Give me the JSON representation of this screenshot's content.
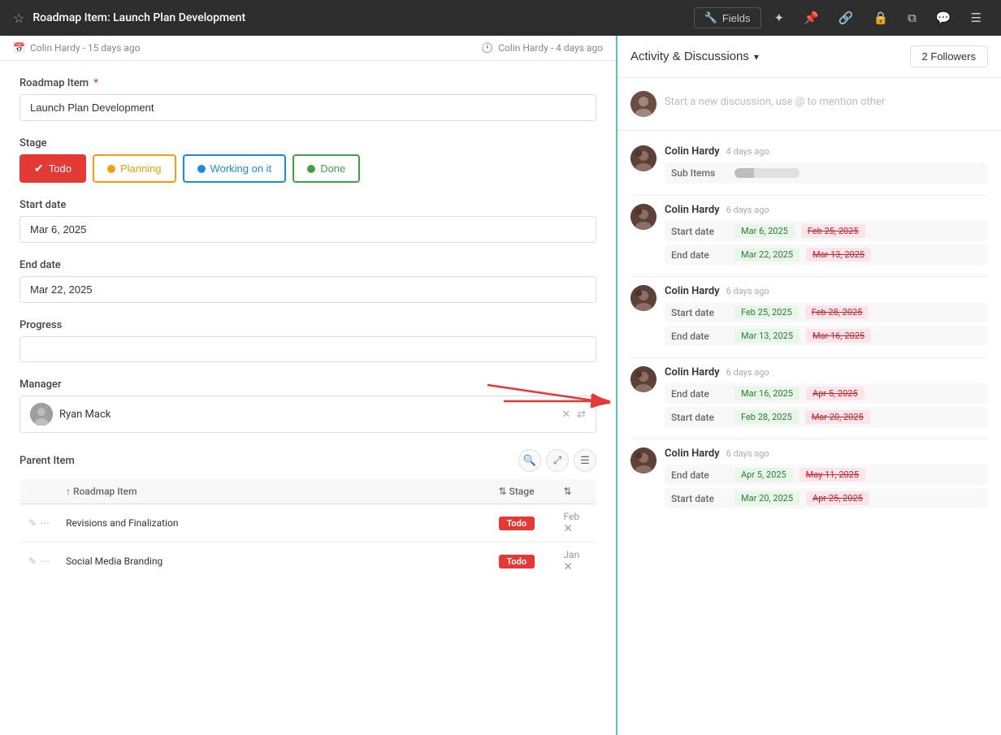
{
  "topbar": {
    "title": "Roadmap Item: Launch Plan Development",
    "fields_label": "Fields"
  },
  "panel_header": {
    "created_by": "Colin Hardy",
    "created_days": "15 days ago",
    "modified_by": "Colin Hardy",
    "modified_days": "4 days ago"
  },
  "form": {
    "roadmap_label": "Roadmap Item",
    "roadmap_value": "Launch Plan Development",
    "stage_label": "Stage",
    "stages": [
      {
        "key": "todo",
        "label": "Todo",
        "class": "todo"
      },
      {
        "key": "planning",
        "label": "Planning",
        "class": "planning"
      },
      {
        "key": "working",
        "label": "Working on it",
        "class": "working"
      },
      {
        "key": "done",
        "label": "Done",
        "class": "done"
      }
    ],
    "start_date_label": "Start date",
    "start_date_value": "Mar 6, 2025",
    "end_date_label": "End date",
    "end_date_value": "Mar 22, 2025",
    "progress_label": "Progress",
    "manager_label": "Manager",
    "manager_name": "Ryan Mack",
    "parent_item_label": "Parent Item",
    "table_headers": [
      "Roadmap Item",
      "Stage",
      ""
    ],
    "table_rows": [
      {
        "name": "Revisions and Finalization",
        "stage": "Todo",
        "date": "Feb"
      },
      {
        "name": "Social Media Branding",
        "stage": "Todo",
        "date": "Jan"
      }
    ]
  },
  "right_panel": {
    "activity_label": "Activity & Discussions",
    "followers_label": "2 Followers",
    "discussion_placeholder": "Start a new discussion, use @ to mention other",
    "activities": [
      {
        "user": "Colin Hardy",
        "time": "4 days ago",
        "changes": [
          {
            "type": "sub_items",
            "label": "Sub Items"
          }
        ]
      },
      {
        "user": "Colin Hardy",
        "time": "6 days ago",
        "changes": [
          {
            "type": "field",
            "label": "Start date",
            "new_val": "Mar 6, 2025",
            "old_val": "Feb 25, 2025"
          },
          {
            "type": "field",
            "label": "End date",
            "new_val": "Mar 22, 2025",
            "old_val": "Mar 13, 2025"
          }
        ]
      },
      {
        "user": "Colin Hardy",
        "time": "6 days ago",
        "changes": [
          {
            "type": "field",
            "label": "Start date",
            "new_val": "Feb 25, 2025",
            "old_val": "Feb 28, 2025"
          },
          {
            "type": "field",
            "label": "End date",
            "new_val": "Mar 13, 2025",
            "old_val": "Mar 16, 2025"
          }
        ]
      },
      {
        "user": "Colin Hardy",
        "time": "6 days ago",
        "changes": [
          {
            "type": "field",
            "label": "End date",
            "new_val": "Mar 16, 2025",
            "old_val": "Apr 5, 2025"
          },
          {
            "type": "field",
            "label": "Start date",
            "new_val": "Feb 28, 2025",
            "old_val": "Mar 20, 2025"
          }
        ]
      },
      {
        "user": "Colin Hardy",
        "time": "6 days ago",
        "changes": [
          {
            "type": "field",
            "label": "End date",
            "new_val": "Apr 5, 2025",
            "old_val": "May 11, 2025"
          },
          {
            "type": "field",
            "label": "Start date",
            "new_val": "Mar 20, 2025",
            "old_val": "Apr 25, 2025"
          }
        ]
      }
    ]
  }
}
